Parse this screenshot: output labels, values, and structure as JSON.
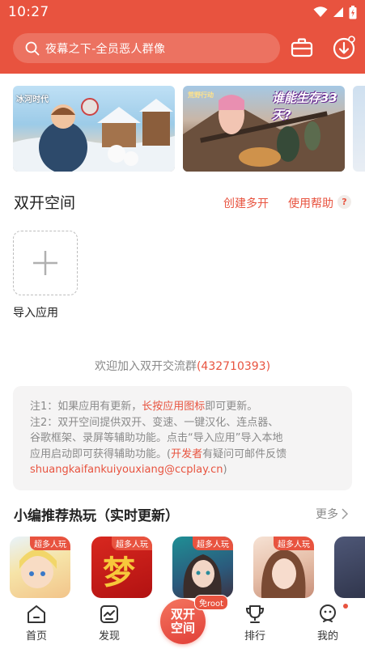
{
  "status_bar": {
    "time": "10:27",
    "icons": [
      "wifi-icon",
      "signal-icon",
      "battery-icon"
    ]
  },
  "header": {
    "search_placeholder": "夜幕之下-全员恶人群像",
    "icons": [
      "search-icon",
      "toolbox-icon",
      "download-icon"
    ],
    "accent_color": "#e8533f"
  },
  "banners": [
    {
      "logo": "冰河时代"
    },
    {
      "logo": "荒野行动",
      "title": "谁能生存33天?"
    },
    {}
  ],
  "dual_space": {
    "title": "双开空间",
    "create_label": "创建多开",
    "help_label": "使用帮助",
    "help_icon": "?",
    "import_label": "导入应用"
  },
  "welcome": {
    "text": "欢迎加入双开交流群",
    "group_number": "(432710393)"
  },
  "notes": {
    "line1_pre": "注1：如果应用有更新，",
    "line1_hl": "长按应用图标",
    "line1_post": "即可更新。",
    "line2": "注2：双开空间提供双开、变速、一键汉化、连点器、",
    "line3": "谷歌框架、录屏等辅助功能。点击“导入应用”导入本地",
    "line4_pre": "应用启动即可获得辅助功能。(",
    "line4_hl": "开发者",
    "line4_post": "有疑问可邮件反馈",
    "line5_email": "shuangkaifankuiyouxiang@ccplay.cn",
    "line5_post": ")"
  },
  "recommend": {
    "title": "小编推荐热玩（实时更新）",
    "more_label": "更多",
    "games": [
      {
        "tag": "超多人玩"
      },
      {
        "tag": "超多人玩"
      },
      {
        "tag": "超多人玩"
      },
      {
        "tag": "超多人玩"
      },
      {
        "tag": "超"
      }
    ]
  },
  "bottom_nav": {
    "items": [
      {
        "label": "首页",
        "icon": "home-icon"
      },
      {
        "label": "发现",
        "icon": "discover-icon"
      },
      {
        "label": "排行",
        "icon": "trophy-icon"
      },
      {
        "label": "我的",
        "icon": "profile-icon"
      }
    ],
    "center_line1": "双开",
    "center_line2": "空间",
    "center_badge": "免root"
  }
}
